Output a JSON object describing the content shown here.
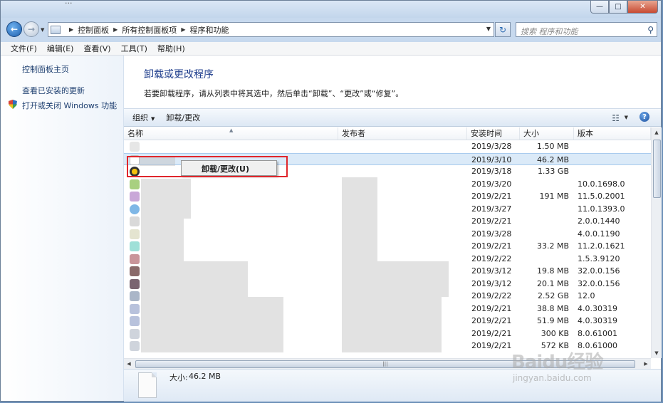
{
  "window": {
    "title": "...",
    "controls": {
      "minimize": "—",
      "maximize": "□",
      "close": "✕"
    }
  },
  "nav": {
    "back_glyph": "←",
    "forward_glyph": "→",
    "breadcrumbs": [
      "控制面板",
      "所有控制面板项",
      "程序和功能"
    ],
    "refresh_glyph": "↻",
    "search_placeholder": "搜索 程序和功能",
    "search_glyph": "⚲"
  },
  "menu": [
    "文件(F)",
    "编辑(E)",
    "查看(V)",
    "工具(T)",
    "帮助(H)"
  ],
  "sidebar": {
    "home_link": "控制面板主页",
    "updates_link": "查看已安装的更新",
    "features_link": "打开或关闭 Windows 功能"
  },
  "main": {
    "title": "卸载或更改程序",
    "description": "若要卸载程序，请从列表中将其选中，然后单击“卸载”、“更改”或“修复”。",
    "toolbar": {
      "organize": "组织",
      "uninstall_change": "卸载/更改",
      "help_glyph": "?"
    }
  },
  "table": {
    "columns": {
      "name": "名称",
      "publisher": "发布者",
      "installed_on": "安装时间",
      "size": "大小",
      "version": "版本"
    },
    "rows": [
      {
        "date": "2019/3/28",
        "size": "1.50 MB",
        "version": ""
      },
      {
        "date": "2019/3/10",
        "size": "46.2 MB",
        "version": "",
        "selected": true
      },
      {
        "date": "2019/3/18",
        "size": "1.33 GB",
        "version": ""
      },
      {
        "date": "2019/3/20",
        "size": "",
        "version": "10.0.1698.0"
      },
      {
        "date": "2019/2/21",
        "size": "191 MB",
        "version": "11.5.0.2001"
      },
      {
        "date": "2019/3/27",
        "size": "",
        "version": "11.0.1393.0"
      },
      {
        "date": "2019/2/21",
        "size": "",
        "version": "2.0.0.1440"
      },
      {
        "date": "2019/3/28",
        "size": "",
        "version": "4.0.0.1190"
      },
      {
        "date": "2019/2/21",
        "size": "33.2 MB",
        "version": "11.2.0.1621"
      },
      {
        "date": "2019/2/22",
        "size": "",
        "version": "1.5.3.9120"
      },
      {
        "date": "2019/3/12",
        "size": "19.8 MB",
        "version": "32.0.0.156"
      },
      {
        "date": "2019/3/12",
        "size": "20.1 MB",
        "version": "32.0.0.156"
      },
      {
        "date": "2019/2/22",
        "size": "2.52 GB",
        "version": "12.0"
      },
      {
        "date": "2019/2/21",
        "size": "38.8 MB",
        "version": "4.0.30319"
      },
      {
        "date": "2019/2/21",
        "size": "51.9 MB",
        "version": "4.0.30319"
      },
      {
        "date": "2019/2/21",
        "size": "300 KB",
        "version": "8.0.61001"
      },
      {
        "date": "2019/2/21",
        "size": "572 KB",
        "version": "8.0.61000"
      }
    ]
  },
  "context_menu": {
    "item": "卸载/更改(U)"
  },
  "details": {
    "size_label": "大小:",
    "size_value": "46.2 MB"
  },
  "watermark": {
    "text": "Baidu经验",
    "url": "jingyan.baidu.com"
  },
  "colors": {
    "title_blue": "#1e3d8c",
    "selection": "#dbeaf8",
    "highlight_red": "#e0262c"
  }
}
